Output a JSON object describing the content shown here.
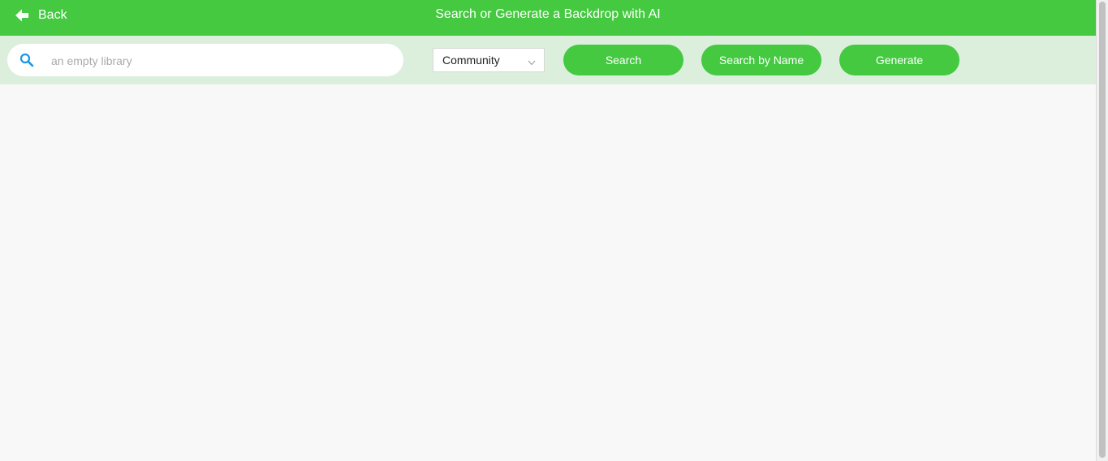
{
  "header": {
    "back_label": "Back",
    "title": "Search or Generate a Backdrop with AI",
    "background_color": "#44c940"
  },
  "toolbar": {
    "search": {
      "value": "",
      "placeholder": "an empty library",
      "icon": "search-icon"
    },
    "source_select": {
      "selected": "Community"
    },
    "buttons": {
      "search_label": "Search",
      "search_by_name_label": "Search by Name",
      "generate_label": "Generate"
    },
    "background_color": "#dcefdc",
    "accent_color": "#44c940"
  },
  "icons": {
    "back": "arrow-left-icon",
    "chevron": "chevron-down-icon"
  }
}
